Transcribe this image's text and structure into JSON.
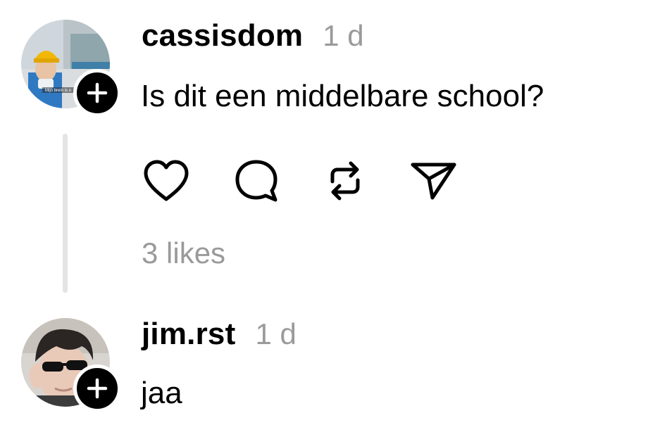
{
  "comments": [
    {
      "username": "cassisdom",
      "timestamp": "1 d",
      "text": "Is dit een middelbare school?",
      "avatar_caption": "Mijn brein is o",
      "avatar_icon": "follow-plus-icon"
    },
    {
      "username": "jim.rst",
      "timestamp": "1 d",
      "text": "jaa",
      "avatar_icon": "follow-plus-icon"
    }
  ],
  "actions": {
    "like_icon": "heart-icon",
    "reply_icon": "comment-bubble-icon",
    "repost_icon": "repost-icon",
    "share_icon": "send-icon"
  },
  "likes_label": "3 likes",
  "colors": {
    "text": "#000000",
    "muted": "#9a9a9a",
    "thread_line": "#e4e4e4",
    "background": "#ffffff"
  }
}
